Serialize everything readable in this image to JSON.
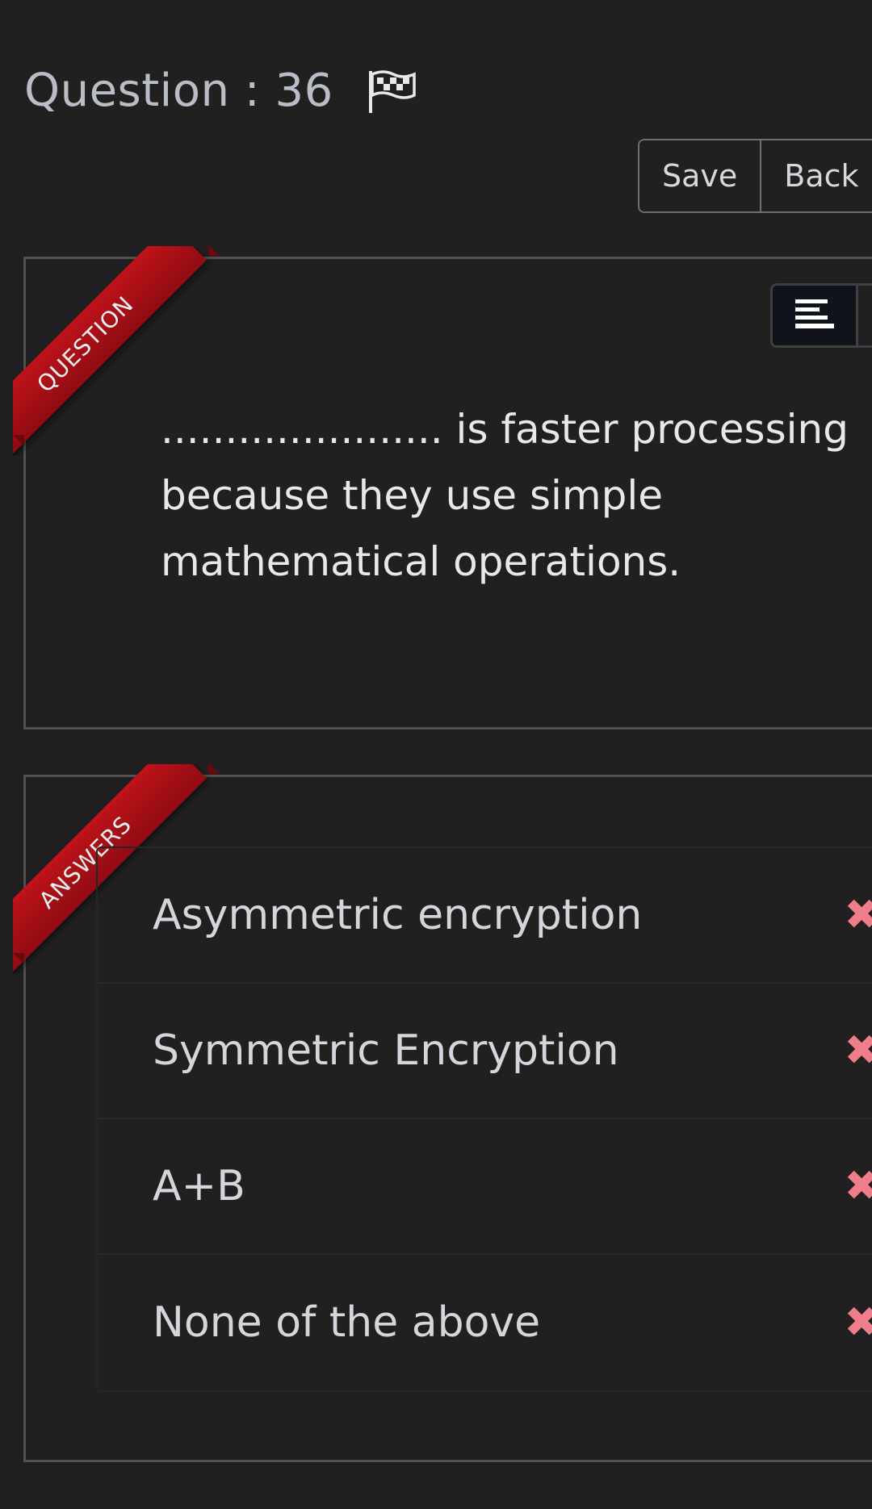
{
  "header": {
    "question_label": "Question : 36",
    "flag_icon": "flag-icon"
  },
  "toolbar": {
    "save_label": "Save",
    "back_label": "Back"
  },
  "question_panel": {
    "ribbon_label": "QUESTION",
    "view_icon": "align-left-icon",
    "text": "...................... is faster processing because they use simple mathematical operations."
  },
  "answers_panel": {
    "ribbon_label": "ANSWERS",
    "options": [
      {
        "label": "Asymmetric encryption",
        "icon": "x-icon"
      },
      {
        "label": "Symmetric Encryption",
        "icon": "x-icon"
      },
      {
        "label": "A+B",
        "icon": "x-icon"
      },
      {
        "label": "None of the above",
        "icon": "x-icon"
      }
    ]
  },
  "colors": {
    "background": "#202020",
    "ribbon": "#b01018",
    "wrong_mark": "#ef7d8c"
  }
}
